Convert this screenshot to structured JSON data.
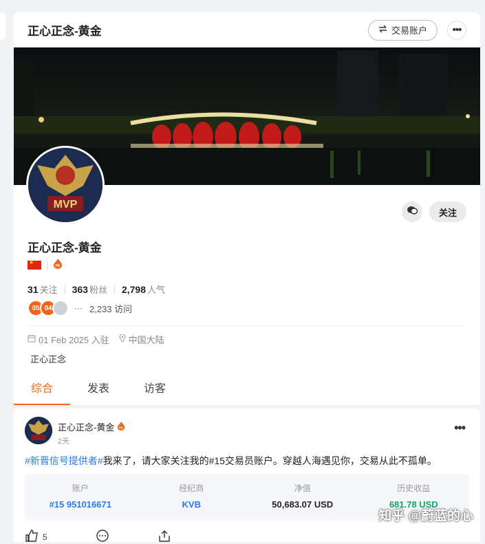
{
  "header": {
    "title": "正心正念-黄金",
    "account_button": "交易账户",
    "more": "•••"
  },
  "profile": {
    "name": "正心正念-黄金",
    "follow_label": "关注",
    "stats": [
      {
        "value": "31",
        "label": "关注"
      },
      {
        "value": "363",
        "label": "粉丝"
      },
      {
        "value": "2,798",
        "label": "人气"
      }
    ],
    "visitors": {
      "dots": [
        "05",
        "04"
      ],
      "ellipsis": "···",
      "count": "2,233 访问"
    },
    "joined": "01 Feb 2025 入驻",
    "location": "中国大陆",
    "bio": "正心正念"
  },
  "tabs": [
    "综合",
    "发表",
    "访客"
  ],
  "post": {
    "author": "正心正念-黄金",
    "time": "2天",
    "tag": "#新晋信号提供者#",
    "text": "我来了，请大家关注我的#15交易员账户。穿越人海遇见你，交易从此不孤单。",
    "columns": [
      {
        "label": "账户",
        "value": "#15 951016671"
      },
      {
        "label": "经纪商",
        "value": "KVB"
      },
      {
        "label": "净值",
        "value": "50,683.07 USD"
      },
      {
        "label": "历史收益",
        "value": "681.78 USD"
      }
    ],
    "likes": "5"
  },
  "watermark": "知乎 @蔚蓝的心",
  "colors": {
    "accent": "#f0651b",
    "link": "#2c7be5",
    "profit": "#1aa260"
  }
}
